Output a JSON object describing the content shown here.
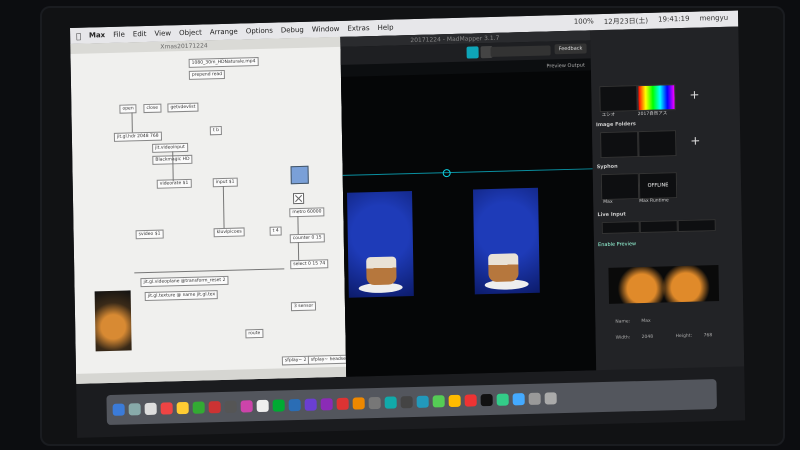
{
  "menubar": {
    "app_name": "Max",
    "items": [
      "File",
      "Edit",
      "View",
      "Object",
      "Arrange",
      "Options",
      "Debug",
      "Window",
      "Extras",
      "Help"
    ],
    "battery": "100%",
    "date": "12月23日(土)",
    "time": "19:41:19",
    "user": "mengyu"
  },
  "patcher": {
    "title": "Xmas20171224",
    "objects": [
      "1080_30m_HDNaturale.mp4",
      "prepend read",
      "open",
      "close",
      "getvdevlist",
      "jit.gl.hdr 2048 768",
      "t b",
      "jit.videoinput",
      "Blackmagic HD",
      "videorate $1",
      "input $1",
      "svideo $1",
      "kluvlpicoes",
      "t 4",
      "jit.gl.videoplane @transform_reset 2",
      "jit.gl.texture @ name jit.gl.tex",
      "metro 60000",
      "counter 0 15",
      "select 0 15 74",
      "3 sensor",
      "route",
      "sfplay~ 2",
      "sfplay~ headset"
    ]
  },
  "madmapper": {
    "title": "20171224 - MadMapper 3.1.7",
    "toolbar": {
      "feedback_label": "Feedback"
    },
    "preview_output_label": "Preview Output"
  },
  "sidebar": {
    "sources": [
      {
        "label": "ユシオ"
      },
      {
        "label": "2017自然アス"
      }
    ],
    "image_folders_label": "Image Folders",
    "syphon_label": "Syphon",
    "syphon_sources": [
      {
        "label": "Max"
      },
      {
        "label": "Max Runtime",
        "status": "OFFLINE"
      }
    ],
    "live_input_label": "Live Input",
    "enable_preview_label": "Enable Preview",
    "name_label": "Name:",
    "name_value": "Max",
    "width_label": "Width:",
    "width_value": "2048",
    "height_label": "Height:",
    "height_value": "768"
  },
  "colors": {
    "accent": "#0ea5b8",
    "stage_bg": "#050607",
    "patcher_bg": "#f0f0ee"
  }
}
